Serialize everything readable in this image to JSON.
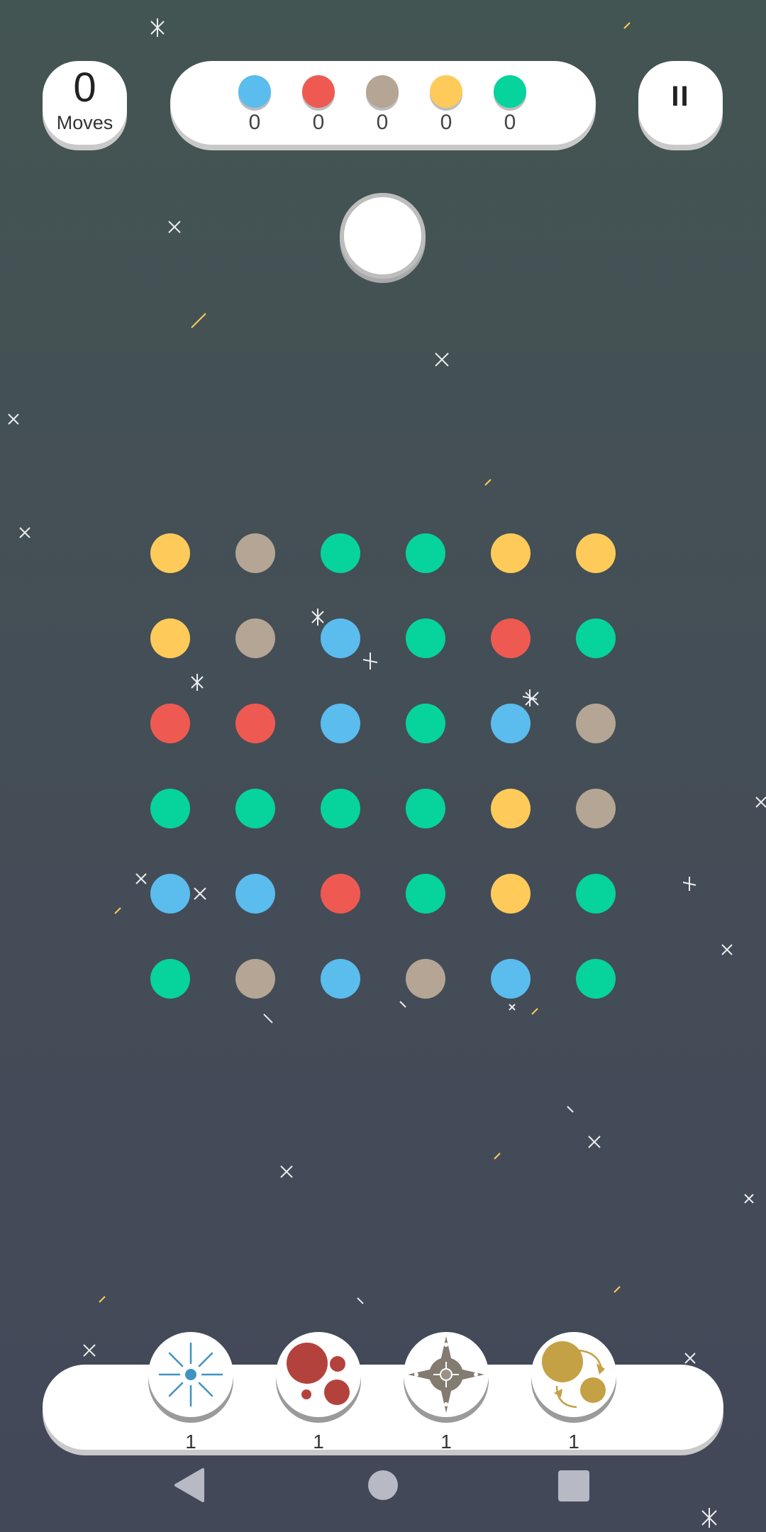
{
  "moves": {
    "count": "0",
    "label": "Moves"
  },
  "goals": [
    {
      "color": "#5bbcee",
      "count": "0"
    },
    {
      "color": "#ee5a52",
      "count": "0"
    },
    {
      "color": "#b5a594",
      "count": "0"
    },
    {
      "color": "#fecb5a",
      "count": "0"
    },
    {
      "color": "#07d39d",
      "count": "0"
    }
  ],
  "pause": {
    "icon": "pause-icon"
  },
  "colors": {
    "blue": "#5bbcee",
    "red": "#ee5a52",
    "taupe": "#b5a594",
    "yellow": "#fecb5a",
    "green": "#07d39d"
  },
  "board": [
    [
      "yellow",
      "taupe",
      "green",
      "green",
      "yellow",
      "yellow"
    ],
    [
      "yellow",
      "taupe",
      "blue",
      "green",
      "red",
      "green"
    ],
    [
      "red",
      "red",
      "blue",
      "green",
      "blue",
      "taupe"
    ],
    [
      "green",
      "green",
      "green",
      "green",
      "yellow",
      "taupe"
    ],
    [
      "blue",
      "blue",
      "red",
      "green",
      "yellow",
      "green"
    ],
    [
      "green",
      "taupe",
      "blue",
      "taupe",
      "blue",
      "green"
    ]
  ],
  "powerups": [
    {
      "name": "expander",
      "icon": "burst-icon",
      "count": "1",
      "color": "#3f93c0"
    },
    {
      "name": "shrinker",
      "icon": "bubbles-icon",
      "count": "1",
      "color": "#b4423c"
    },
    {
      "name": "bomb",
      "icon": "compass-star-icon",
      "count": "1",
      "color": "#837a70"
    },
    {
      "name": "swap",
      "icon": "orbit-icon",
      "count": "1",
      "color": "#c4a145"
    }
  ],
  "navbar": {
    "back": "back-icon",
    "home": "home-icon",
    "recents": "recents-icon"
  }
}
